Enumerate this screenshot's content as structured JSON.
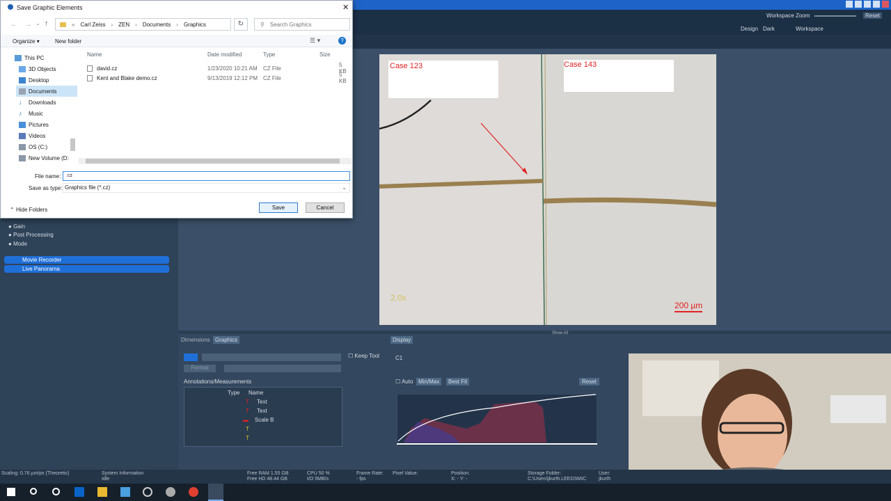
{
  "app": {
    "workspace_zoom": "Workspace Zoom",
    "reset": "Reset",
    "design_label": "Design",
    "design_value": "Dark",
    "workspace_label": "Workspace"
  },
  "dialog": {
    "title": "Save Graphic Elements",
    "breadcrumb": [
      "«",
      "Carl Zeiss",
      "ZEN",
      "Documents",
      "Graphics"
    ],
    "search_placeholder": "Search Graphics",
    "organize": "Organize",
    "new_folder": "New folder",
    "nav": [
      "This PC",
      "3D Objects",
      "Desktop",
      "Documents",
      "Downloads",
      "Music",
      "Pictures",
      "Videos",
      "OS (C:)",
      "New Volume (D:"
    ],
    "columns": [
      "Name",
      "Date modified",
      "Type",
      "Size"
    ],
    "files": [
      {
        "name": "david.cz",
        "date": "1/23/2020 10:21 AM",
        "type": "CZ File",
        "size": "5 KB"
      },
      {
        "name": "Kent and Blake demo.cz",
        "date": "9/13/2019 12:12 PM",
        "type": "CZ File",
        "size": "5 KB"
      }
    ],
    "file_name_label": "File name:",
    "file_name_value": ".cz",
    "save_as_label": "Save as type:",
    "save_as_value": "Graphics file (*.cz)",
    "hide_folders": "Hide Folders",
    "save": "Save",
    "cancel": "Cancel"
  },
  "left_panel": {
    "items": [
      "Gain",
      "Post Processing",
      "Mode"
    ],
    "tools": [
      "Movie Recorder",
      "Live Panorama"
    ]
  },
  "viewer": {
    "left_label": "Case 123",
    "right_label": "Case 143",
    "magnification": "2.0x",
    "scale_bar": "200 µm",
    "show_all": "Show All"
  },
  "graphics_panel": {
    "tabs": [
      "Dimensions",
      "Graphics"
    ],
    "keep_tool": "Keep Tool",
    "format": "Format",
    "section_title": "Annotations/Measurements",
    "columns": [
      "Type",
      "Name"
    ],
    "rows": [
      "Text",
      "Text",
      "Scale B",
      "",
      ""
    ]
  },
  "display_panel": {
    "tab": "Display",
    "channel": "C1",
    "auto": "Auto",
    "minmax": "Min/Max",
    "best_fit": "Best Fit",
    "reset": "Reset"
  },
  "status": {
    "scaling": "Scaling:  0.76 µm/px (Theoretic)",
    "sys_info": "System Information",
    "sys_state": "Idle",
    "ram": "Free RAM  1.55 GB",
    "hd": "Free HD   48.44 GB",
    "cpu": "CPU  50 %",
    "io": "I/O  5MB/s",
    "frame_rate": "Frame Rate:",
    "fps": "- fps",
    "pixel_value": "Pixel Value:",
    "position": "Position:",
    "pos_xy": "X: -   Y: -",
    "storage": "Storage Folder:",
    "storage_path": "C:\\Users\\jkurth.LEEDSMIC",
    "user": "User:",
    "user_name": "jkurth"
  },
  "colors": {
    "accent": "#1f6fd8",
    "annotation_red": "#e02020"
  }
}
